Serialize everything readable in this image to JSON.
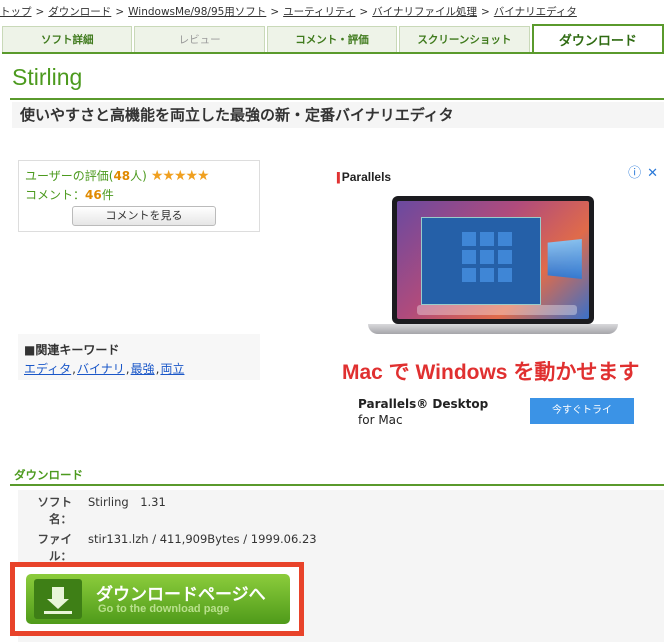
{
  "breadcrumb": [
    "トップ",
    "ダウンロード",
    "WindowsMe/98/95用ソフト",
    "ユーティリティ",
    "バイナリファイル処理",
    "バイナリエディタ"
  ],
  "breadcrumb_separator": ">",
  "tabs": [
    {
      "label": "ソフト詳細"
    },
    {
      "label": "レビュー"
    },
    {
      "label": "コメント・評価"
    },
    {
      "label": "スクリーンショット"
    },
    {
      "label": "ダウンロード"
    }
  ],
  "active_tab": "ダウンロード",
  "software": {
    "title": "Stirling",
    "tagline": "使いやすさと高機能を両立した最強の新・定番バイナリエディタ"
  },
  "rating": {
    "label_prefix": "ユーザーの評価(",
    "count": "48",
    "label_suffix": "人)",
    "stars": "★★★★★",
    "comment_prefix": "コメント：",
    "comment_count": "46",
    "comment_suffix": "件",
    "comment_button": "コメントを見る"
  },
  "keywords": {
    "title": "■関連キーワード",
    "items": [
      "エディタ",
      "バイナリ",
      "最強",
      "両立"
    ],
    "separator": ","
  },
  "ad": {
    "info_icon": "ⓘ",
    "close_icon": "✕",
    "brand_bars": "||",
    "brand": "Parallels",
    "headline": "Mac で Windows を動かせます",
    "product_line1": "Parallels® Desktop",
    "product_line2": "for Mac",
    "cta": "今すぐトライ"
  },
  "download": {
    "heading": "ダウンロード",
    "rows": [
      {
        "label1": "ソフト",
        "label2": "名：",
        "value": "Stirling　1.31"
      },
      {
        "label1": "ファイ",
        "label2": "ル：",
        "value": "stir131.lzh / 411,909Bytes / 1999.06.23"
      }
    ],
    "button_text": "ダウンロードページへ",
    "button_subtext": "Go to the download page"
  },
  "colors": {
    "accent_green": "#5a9a2c",
    "title_green": "#4c9a1e",
    "highlight_red": "#e8432a",
    "ad_red": "#e03030",
    "link_blue": "#1a57c8"
  }
}
